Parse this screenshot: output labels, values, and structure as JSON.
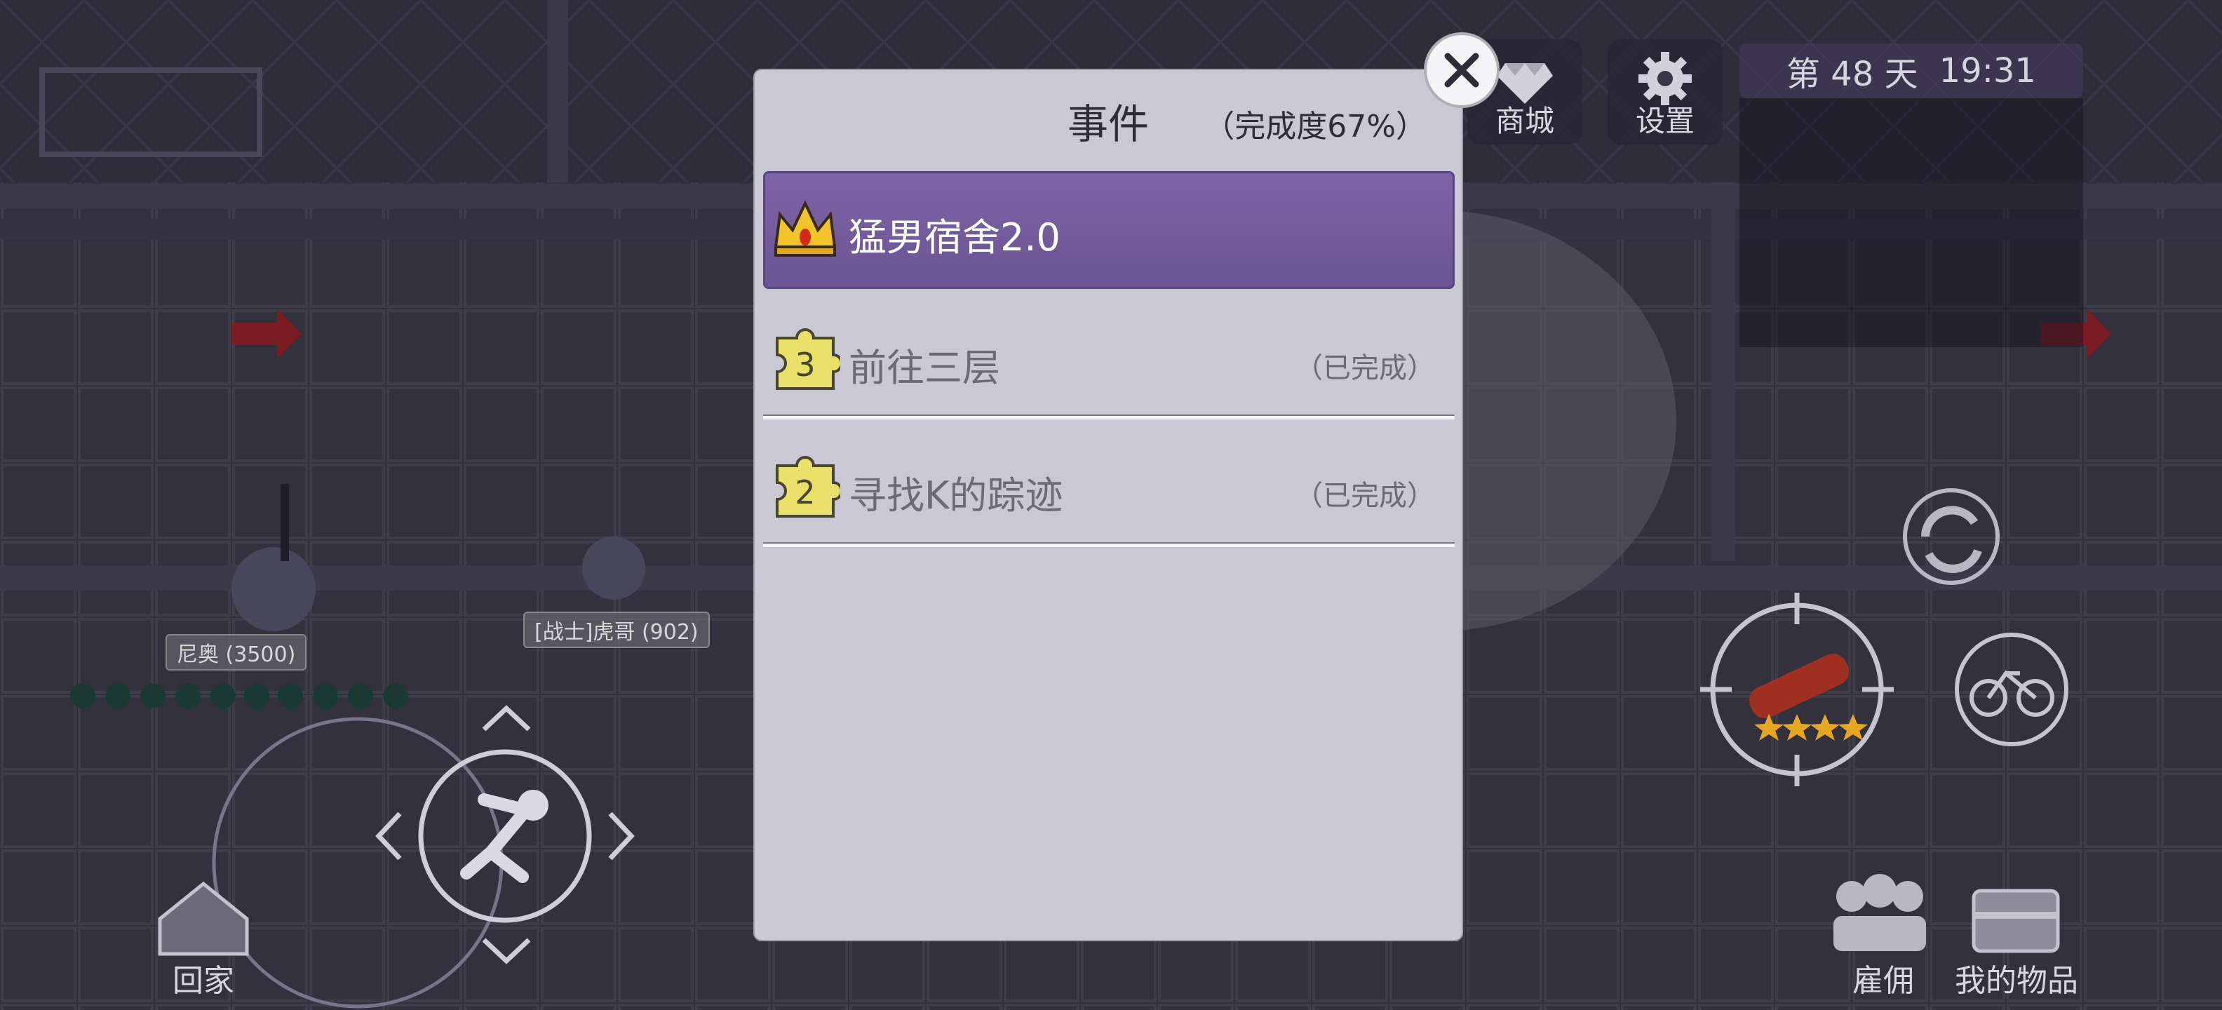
{
  "hud": {
    "shop": {
      "label": "商城",
      "icon": "diamond-icon"
    },
    "settings": {
      "label": "设置",
      "icon": "gear-icon"
    },
    "day_text": "第 48 天",
    "time_text": "19:31",
    "home_label": "回家",
    "hire_label": "雇佣",
    "items_label": "我的物品",
    "weapon_stars": 4
  },
  "characters": [
    {
      "name": "尼奥 (3500)"
    },
    {
      "name": "[战士]虎哥 (902)"
    }
  ],
  "dialog": {
    "title": "事件",
    "progress": "（完成度67%）",
    "events": [
      {
        "title": "猛男宿舍2.0",
        "status": "",
        "icon": "crown-icon",
        "active": true
      },
      {
        "title": "前往三层",
        "status": "（已完成）",
        "icon": "puzzle-piece-icon",
        "badge": "3",
        "active": false
      },
      {
        "title": "寻找K的踪迹",
        "status": "（已完成）",
        "icon": "puzzle-piece-icon",
        "badge": "2",
        "active": false
      }
    ]
  },
  "colors": {
    "dialog_bg": "#c9c8d4",
    "active_row": "#735a9c",
    "puzzle": "#e9e06a"
  }
}
